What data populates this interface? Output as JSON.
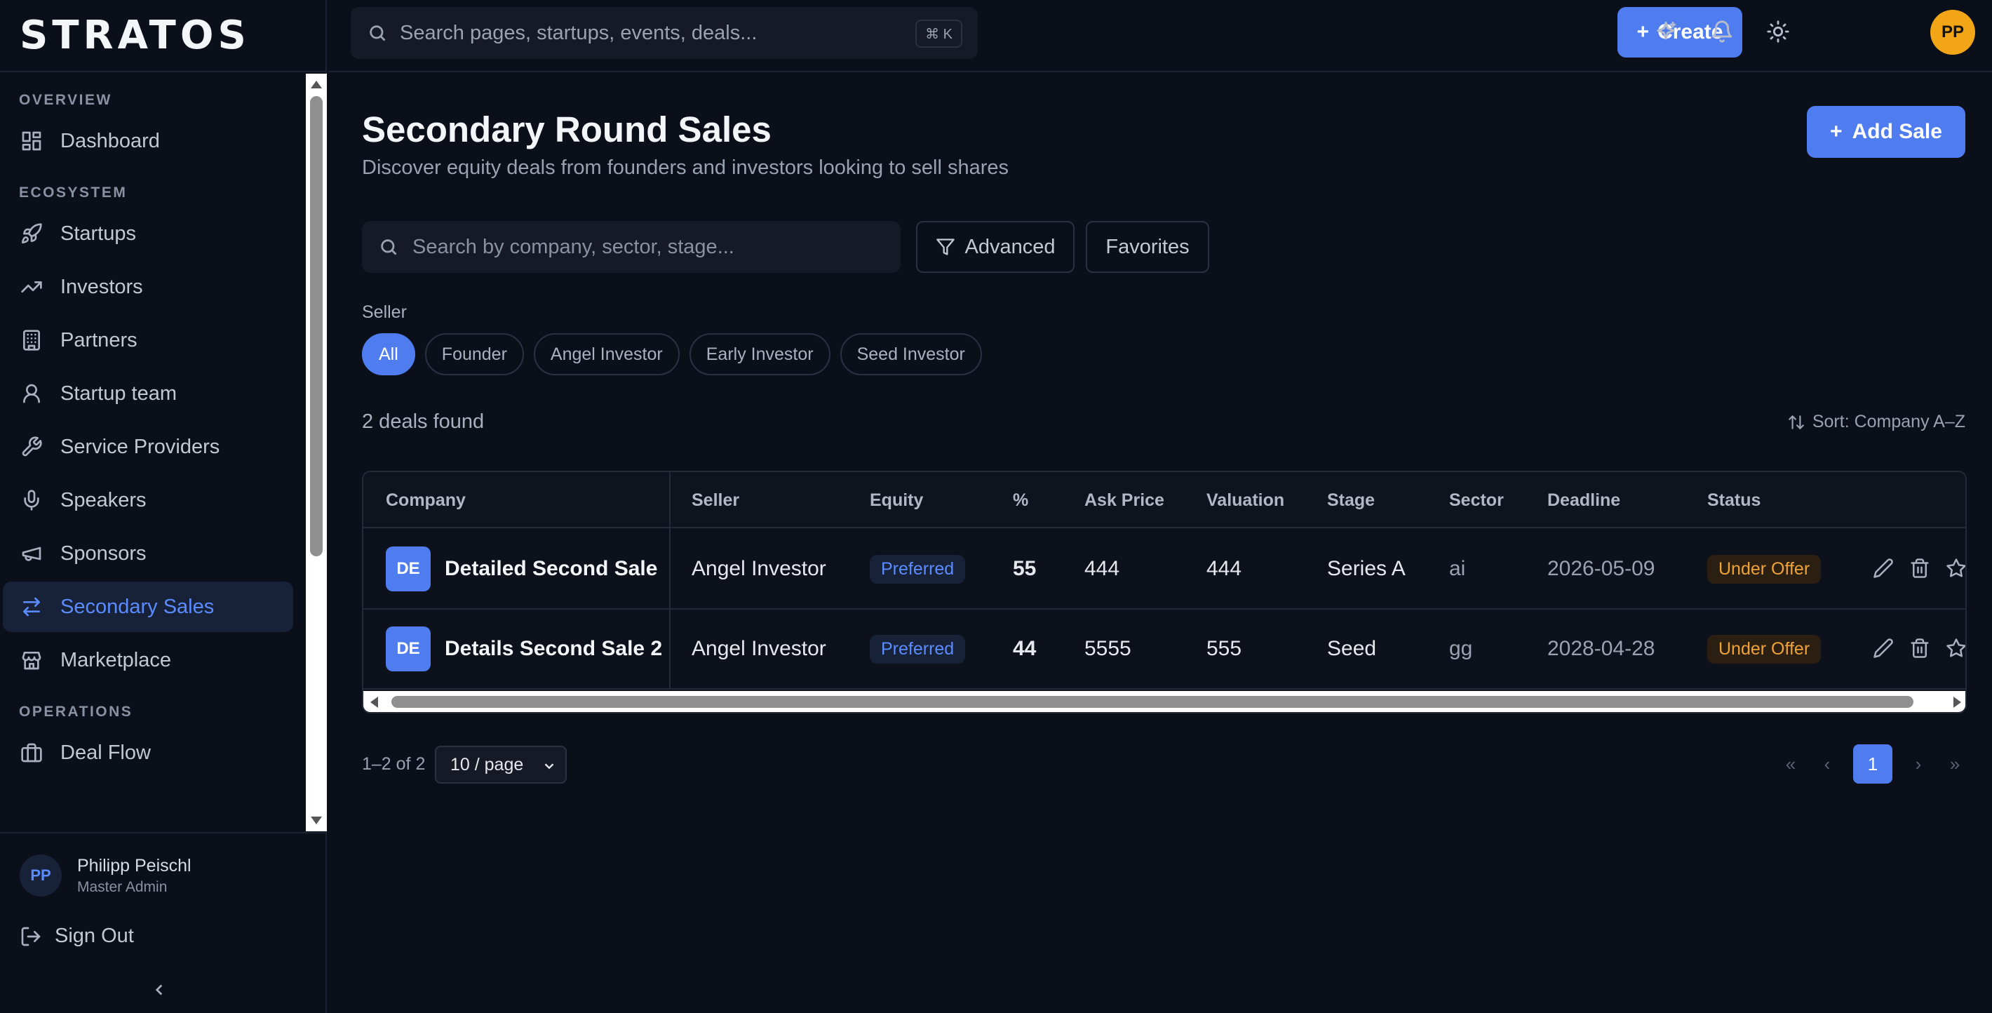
{
  "app": {
    "logo": "STRATOS"
  },
  "topbar": {
    "search_placeholder": "Search pages, startups, events, deals...",
    "shortcut": "⌘ K",
    "create_label": "Create",
    "avatar_initials": "PP"
  },
  "sidebar": {
    "sections": [
      {
        "label": "OVERVIEW"
      },
      {
        "label": "ECOSYSTEM"
      },
      {
        "label": "OPERATIONS"
      }
    ],
    "items": [
      {
        "label": "Dashboard",
        "icon": "dashboard-icon"
      },
      {
        "label": "Startups",
        "icon": "rocket-icon"
      },
      {
        "label": "Investors",
        "icon": "trending-up-icon"
      },
      {
        "label": "Partners",
        "icon": "building-icon"
      },
      {
        "label": "Startup team",
        "icon": "user-icon"
      },
      {
        "label": "Service Providers",
        "icon": "wrench-icon"
      },
      {
        "label": "Speakers",
        "icon": "microphone-icon"
      },
      {
        "label": "Sponsors",
        "icon": "megaphone-icon"
      },
      {
        "label": "Secondary Sales",
        "icon": "swap-arrows-icon",
        "active": true
      },
      {
        "label": "Marketplace",
        "icon": "store-icon"
      },
      {
        "label": "Deal Flow",
        "icon": "briefcase-icon"
      }
    ],
    "user": {
      "initials": "PP",
      "name": "Philipp Peischl",
      "role": "Master Admin"
    },
    "sign_out": "Sign Out"
  },
  "page": {
    "title": "Secondary Round Sales",
    "subtitle": "Discover equity deals from founders and investors looking to sell shares",
    "add_button": "Add Sale",
    "search_placeholder": "Search by company, sector, stage...",
    "advanced_label": "Advanced",
    "favorites_label": "Favorites",
    "filter_label": "Seller",
    "seller_chips": [
      "All",
      "Founder",
      "Angel Investor",
      "Early Investor",
      "Seed Investor"
    ],
    "active_chip": "All",
    "count_text": "2 deals found",
    "sort_text": "Sort: Company A–Z"
  },
  "table": {
    "columns": [
      "Company",
      "Seller",
      "Equity",
      "%",
      "Ask Price",
      "Valuation",
      "Stage",
      "Sector",
      "Deadline",
      "Status"
    ],
    "rows": [
      {
        "initials": "DE",
        "company": "Detailed Second Sale",
        "seller": "Angel Investor",
        "equity": "Preferred",
        "percent": "55",
        "ask_price": "444",
        "valuation": "444",
        "stage": "Series A",
        "sector": "ai",
        "deadline": "2026-05-09",
        "status": "Under Offer"
      },
      {
        "initials": "DE",
        "company": "Details Second Sale 2",
        "seller": "Angel Investor",
        "equity": "Preferred",
        "percent": "44",
        "ask_price": "5555",
        "valuation": "555",
        "stage": "Seed",
        "sector": "gg",
        "deadline": "2028-04-28",
        "status": "Under Offer"
      }
    ]
  },
  "pagination": {
    "range": "1–2 of 2",
    "page_size": "10 / page",
    "first": "«",
    "prev": "‹",
    "current": "1",
    "next": "›",
    "last": "»"
  },
  "colors": {
    "accent": "#4f7df0",
    "background": "#0b0f19",
    "status_warning": "#f0a23a",
    "avatar": "#f2a516"
  }
}
